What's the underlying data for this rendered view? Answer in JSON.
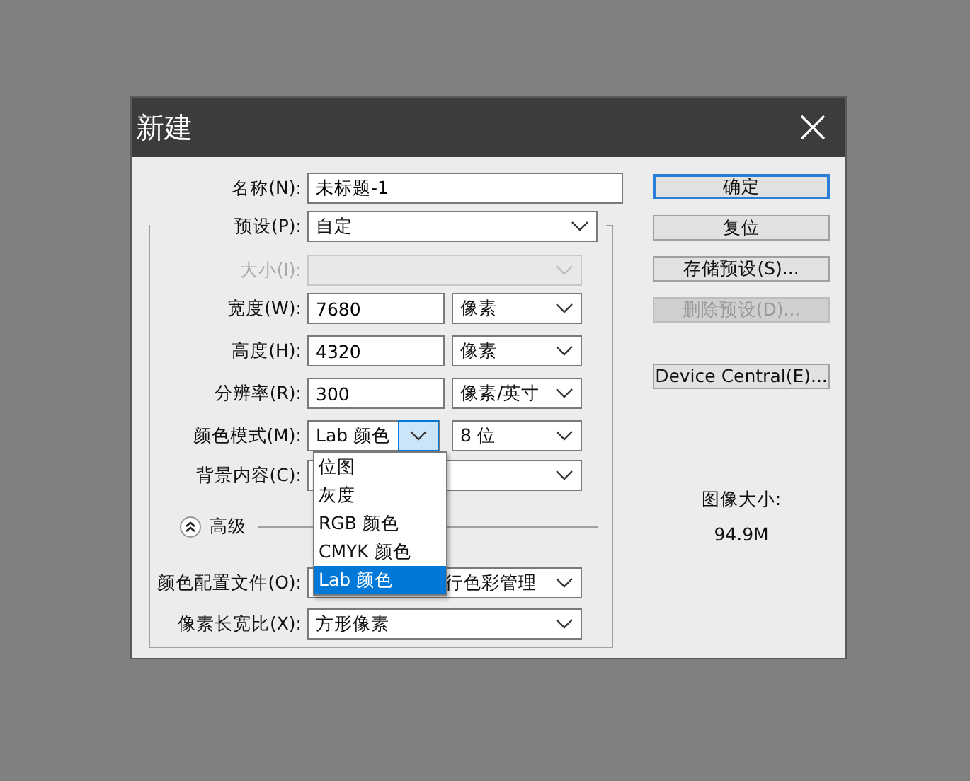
{
  "window": {
    "title": "新建"
  },
  "name": {
    "label": "名称(N):",
    "value": "未标题-1"
  },
  "fields": [
    {
      "kind": "select",
      "label": "预设(P):",
      "value": "自定",
      "disabled": false
    },
    {
      "kind": "select",
      "label": "大小(I):",
      "disabled": true
    },
    {
      "kind": "number",
      "label": "宽度(W):",
      "value": "7680",
      "unit": "像素",
      "disabled": false
    },
    {
      "kind": "number",
      "label": "高度(H):",
      "value": "4320",
      "unit": "像素",
      "disabled": false
    },
    {
      "kind": "number",
      "label": "分辨率(R):",
      "value": "300",
      "unit": "像素/英寸",
      "disabled": false
    },
    {
      "kind": "mode",
      "label": "颜色模式(M):",
      "value": "Lab 颜色",
      "depth": "8 位",
      "expanded": true,
      "disabled": false
    },
    {
      "kind": "select",
      "label": "背景内容(C):",
      "disabled": false
    }
  ],
  "dropdown": {
    "options": [
      {
        "label": "位图",
        "selected": false
      },
      {
        "label": "灰度",
        "selected": false
      },
      {
        "label": "RGB 颜色",
        "selected": false
      },
      {
        "label": "CMYK 颜色",
        "selected": false
      },
      {
        "label": "Lab 颜色",
        "selected": true
      }
    ]
  },
  "advanced": {
    "label": "高级",
    "expanded": true
  },
  "advanced_fields": [
    {
      "label": "颜色配置文件(O):",
      "value": "行色彩管理"
    },
    {
      "label": "像素长宽比(X):",
      "value": "方形像素"
    }
  ],
  "buttons": [
    {
      "label": "确定",
      "default": true,
      "disabled": false
    },
    {
      "label": "复位",
      "default": false,
      "disabled": false
    },
    {
      "label": "存储预设(S)...",
      "default": false,
      "disabled": false
    },
    {
      "label": "删除预设(D)...",
      "default": false,
      "disabled": true
    },
    {
      "label": "Device Central(E)...",
      "default": false,
      "disabled": false
    }
  ],
  "image_size": {
    "label": "图像大小:",
    "value": "94.9M"
  }
}
